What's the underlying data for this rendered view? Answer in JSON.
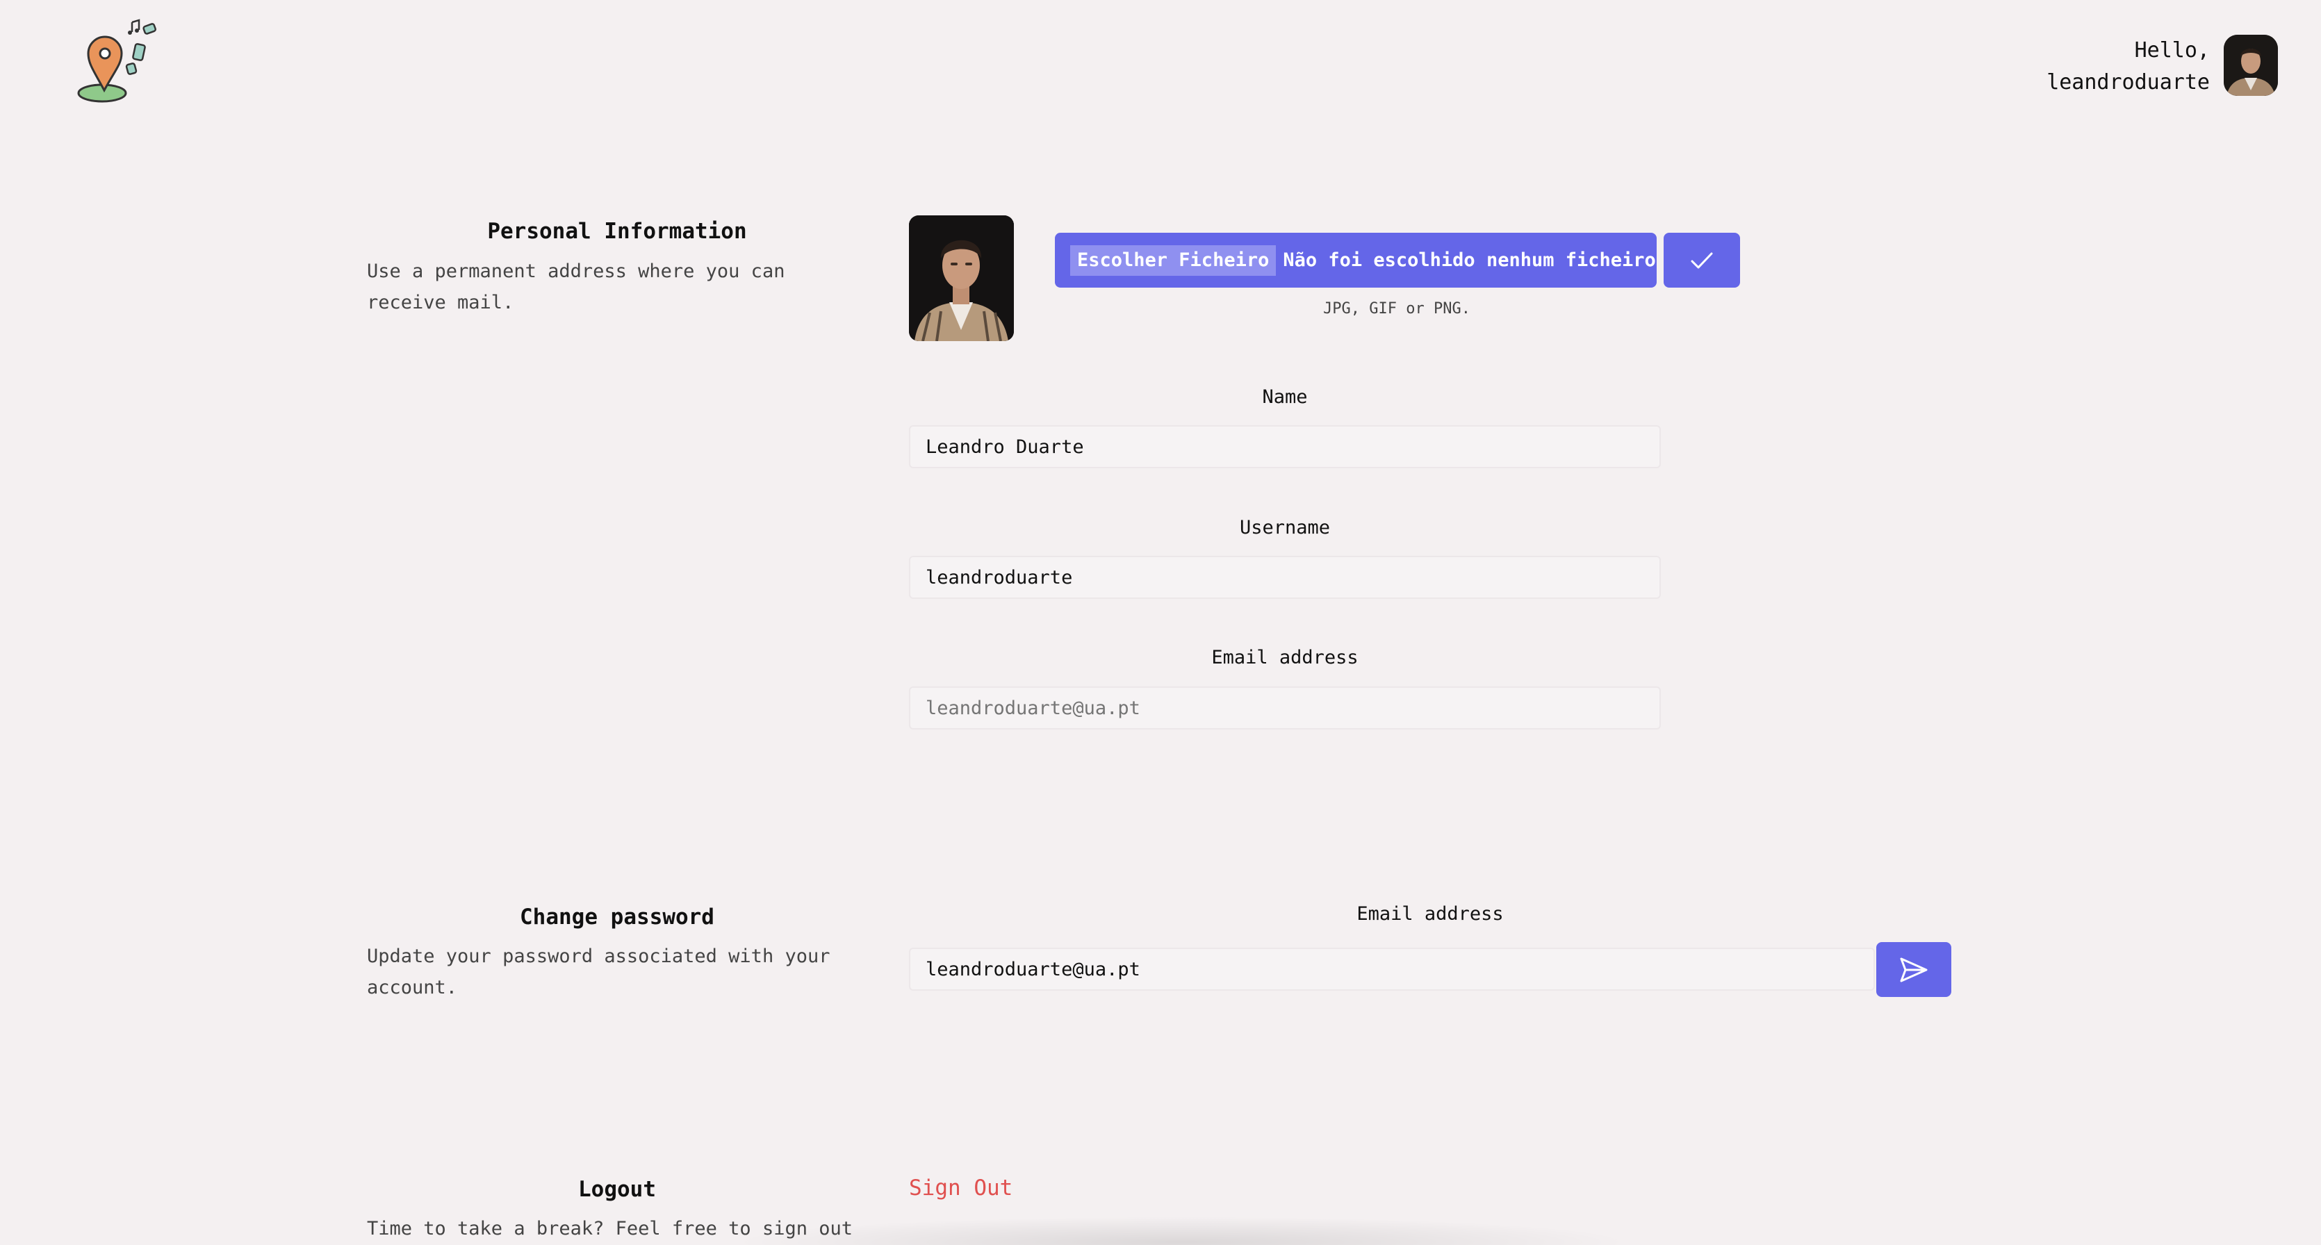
{
  "header": {
    "greeting_line1": "Hello,",
    "greeting_line2": "leandroduarte",
    "logo_icon": "map-pin-music-logo",
    "avatar_icon": "user-avatar"
  },
  "personal_info": {
    "title": "Personal Information",
    "description": "Use a permanent address where you can receive mail.",
    "file_button_label": "Escolher Ficheiro",
    "file_status": "Não foi escolhido nenhum ficheiro",
    "file_hint": "JPG, GIF or PNG.",
    "confirm_icon": "checkmark-icon",
    "name_label": "Name",
    "name_value": "Leandro Duarte",
    "username_label": "Username",
    "username_value": "leandroduarte",
    "email_label": "Email address",
    "email_placeholder": "leandroduarte@ua.pt"
  },
  "change_password": {
    "title": "Change password",
    "description": "Update your password associated with your account.",
    "email_label": "Email address",
    "email_value": "leandroduarte@ua.pt",
    "send_icon": "send-icon"
  },
  "logout": {
    "title": "Logout",
    "description": "Time to take a break? Feel free to sign out",
    "signout_label": "Sign Out"
  },
  "colors": {
    "accent": "#6466e8",
    "background": "#f4f0f1",
    "danger": "#e0504f"
  }
}
